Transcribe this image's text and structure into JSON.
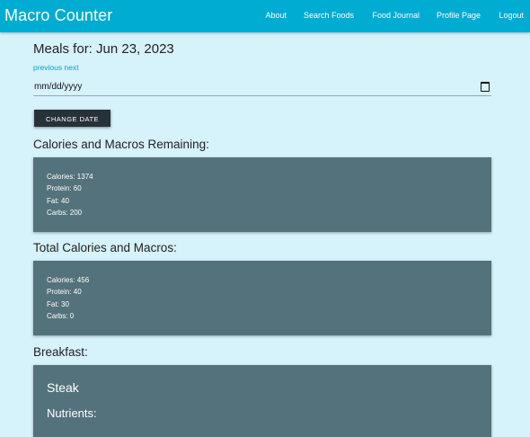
{
  "app": {
    "title": "Macro Counter"
  },
  "nav": {
    "links": [
      "About",
      "Search Foods",
      "Food Journal",
      "Profile Page",
      "Logout"
    ]
  },
  "meals": {
    "title": "Meals for: Jun 23, 2023",
    "previous_label": "previous",
    "next_label": "next",
    "date_placeholder": "mm/dd/yyyy",
    "change_date_label": "CHANGE DATE"
  },
  "remaining": {
    "title": "Calories and Macros Remaining:",
    "lines": [
      "Calories: 1374",
      "Protein: 60",
      "Fat: 40",
      "Carbs: 200"
    ]
  },
  "totals": {
    "title": "Total Calories and Macros:",
    "lines": [
      "Calories: 456",
      "Protein: 40",
      "Fat: 30",
      "Carbs: 0"
    ]
  },
  "breakfast": {
    "title": "Breakfast:",
    "food_name": "Steak",
    "nutrients_label": "Nutrients:"
  },
  "icons": {
    "date_picker": "calendar-icon"
  },
  "colors": {
    "navbar": "#00acd2",
    "page_bg": "#d6f2fb",
    "card": "#54727b",
    "button": "#263238",
    "link": "#0aa0c8"
  }
}
